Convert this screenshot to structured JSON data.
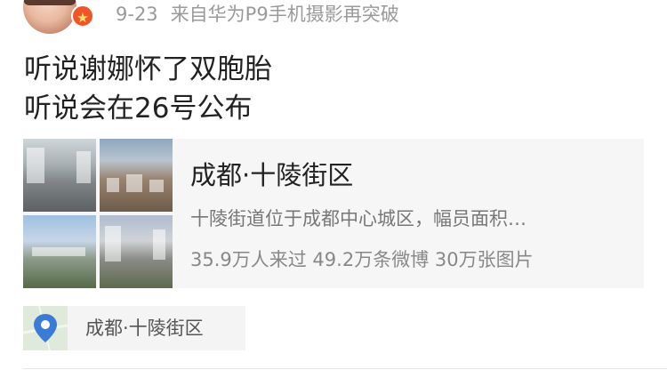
{
  "post": {
    "time": "9-23",
    "source": "来自华为P9手机摄影再突破",
    "text_lines": [
      "听说谢娜怀了双胞胎",
      "听说会在26号公布"
    ]
  },
  "location_card": {
    "title": "成都·十陵街区",
    "description": "十陵街道位于成都中心城区，幅员面积…",
    "stats": "35.9万人来过 49.2万条微博 30万张图片",
    "photos": [
      "street-photo",
      "city-hillside-photo",
      "aerial-city-photo",
      "buildings-photo"
    ]
  },
  "location_tag": {
    "label": "成都·十陵街区",
    "icon": "location-pin-icon"
  },
  "colors": {
    "pin": "#3a7bd5",
    "badge": "#f0552a"
  }
}
